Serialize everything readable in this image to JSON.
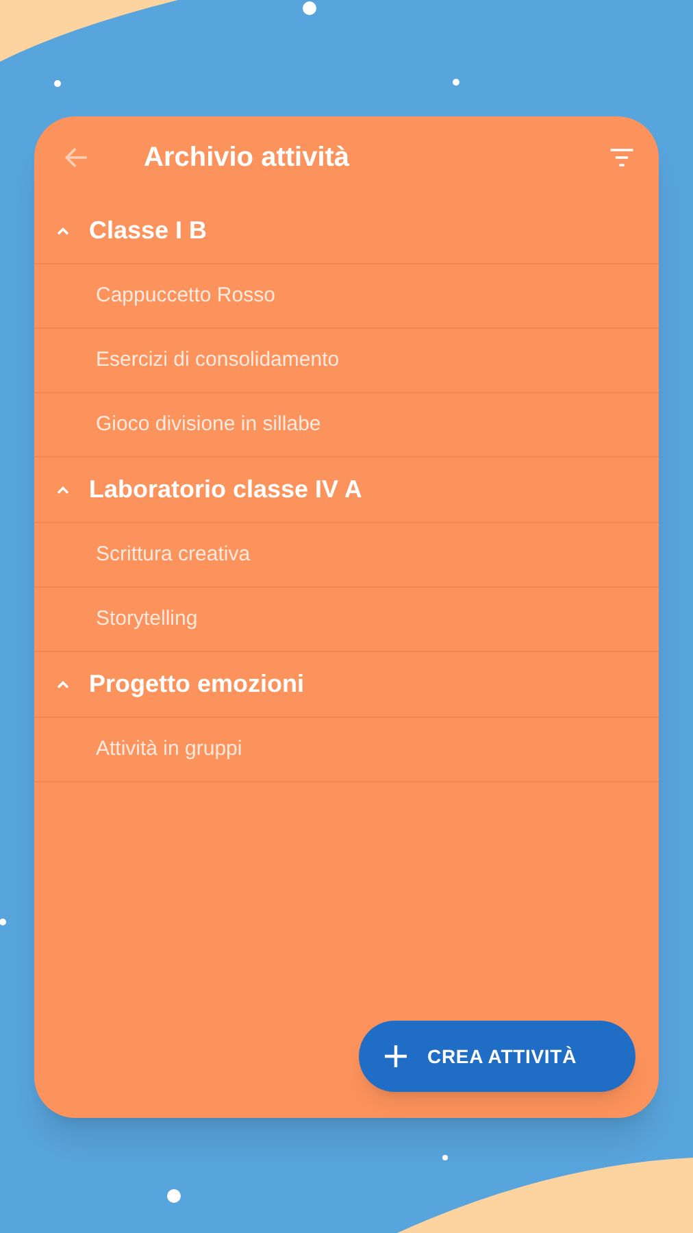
{
  "header": {
    "title": "Archivio attività"
  },
  "groups": [
    {
      "title": "Classe I B",
      "expanded": true,
      "children": [
        {
          "title": "Cappuccetto Rosso"
        },
        {
          "title": "Esercizi di consolidamento"
        },
        {
          "title": "Gioco divisione in sillabe"
        }
      ]
    },
    {
      "title": "Laboratorio classe IV A",
      "expanded": true,
      "children": [
        {
          "title": "Scrittura creativa"
        },
        {
          "title": "Storytelling"
        }
      ]
    },
    {
      "title": "Progetto emozioni",
      "expanded": true,
      "children": [
        {
          "title": "Attività in gruppi"
        }
      ]
    }
  ],
  "fab": {
    "label": "CREA ATTIVITÀ"
  }
}
